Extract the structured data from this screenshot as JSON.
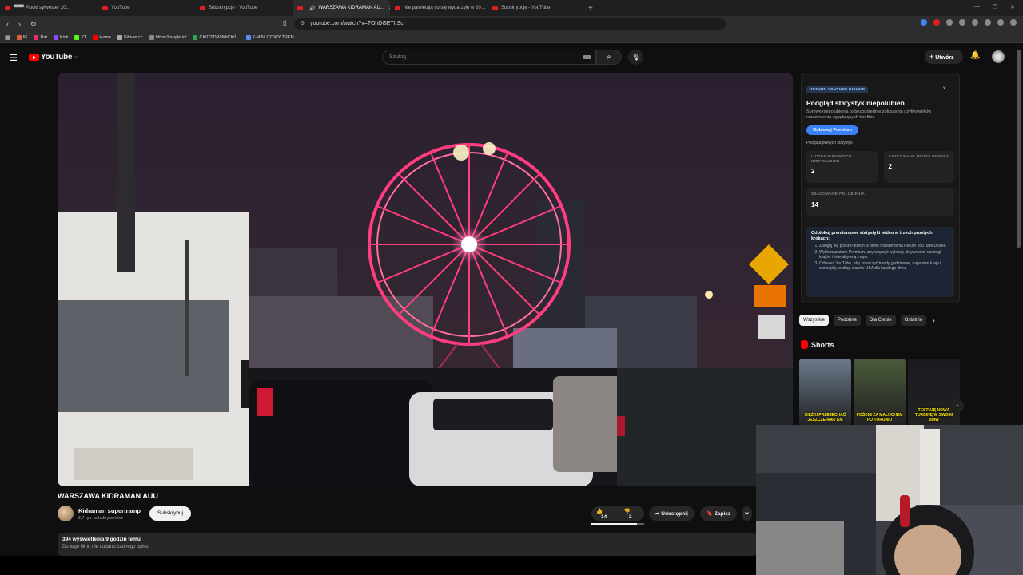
{
  "browser": {
    "tabs": [
      {
        "label": "▀▀▀ Płocki sylwester 20…",
        "active": false
      },
      {
        "label": "YouTube",
        "active": false
      },
      {
        "label": "Subskrypcje - YouTube",
        "active": false
      },
      {
        "label": "WARSZAWA KIDRAMAN AU…",
        "active": true
      },
      {
        "label": "Nie pamiętają co się wydarzyło w 20…",
        "active": false
      },
      {
        "label": "Subskrypcje - YouTube",
        "active": false
      }
    ],
    "new_tab": "+",
    "url": "youtube.com/watch?v=TOhDGETItSc",
    "bookmarks": [
      "IG",
      "Rat",
      "Kick",
      "YT",
      "Home",
      "Filman.cc",
      "https://tangle.io/",
      "CK0T0DR0N#CK0...",
      "7-MINUTOWY TREN..."
    ]
  },
  "youtube": {
    "logo": "YouTube",
    "logo_country": "PL",
    "search_placeholder": "Szukaj",
    "create_label": "Utwórz"
  },
  "video": {
    "title": "WARSZAWA KIDRAMAN AUU",
    "channel": "Kidraman supertramp",
    "subscribers": "2,7 tys. subskrybentów",
    "subscribe_label": "Subskrybuj",
    "likes": "14",
    "dislikes": "2",
    "share_label": "Udostępnij",
    "save_label": "Zapisz",
    "stats": "394 wyświetlenia  9 godzin temu",
    "no_description": "Do tego filmu nie dodano żadnego opisu."
  },
  "ryd": {
    "badge": "RETURN YOUTUBE DISLIKE",
    "heading": "Podgląd statystyk niepolubień",
    "subtitle": "Surowe niepolubienia to bezpośrednie zgłoszenia użytkowników rozszerzenia oglądających ten film.",
    "unlock_label": "Odblokuj Premium",
    "preview_link": "Podgląd pełnych statystyk",
    "raw_label": "LICZBA SUROWYCH NIEPOLUBIEŃ",
    "raw_value": "2",
    "est_dislikes_label": "SZACOWANE NIEPOLUBIENIA",
    "est_dislikes_value": "2",
    "est_likes_label": "SZACOWANE POLUBIENIA",
    "est_likes_value": "14",
    "promo_heading": "Odblokuj premiumowe statystyki wideo w trzech prostych krokach:",
    "promo_steps": [
      "Zaloguj się przez Patreon w oknie rozszerzenia Return YouTube Dislike.",
      "Wybierz poziom Premium, aby włączyć wykresy aktywności, rankingi krajów i interaktywną mapę.",
      "Odśwież YouTube, aby zobaczyć trendy godzinowe, najlepsze kraje i szczegóły według stanów USA dla każdego filmu."
    ]
  },
  "chips": [
    "Wszystkie",
    "Podobne",
    "Dla Ciebie",
    "Ostatnio"
  ],
  "shorts": {
    "heading": "Shorts",
    "items": [
      {
        "caption": "CIĘŻKI PRZEJECHAĆ JESZCZE 4860 KM",
        "bg": "#6b7a8c"
      },
      {
        "caption": "POŚCIG ZA MALUCHEM PO TORUNIU",
        "bg": "#4a5a3a"
      },
      {
        "caption": "TESTUJĘ NOWĄ TURBINĘ W SWOIM BMW",
        "bg": "#1a1a22"
      }
    ]
  },
  "colors": {
    "accent": "#ff0000",
    "ryd_button": "#3b82f6",
    "bg": "#0f0f0f"
  }
}
